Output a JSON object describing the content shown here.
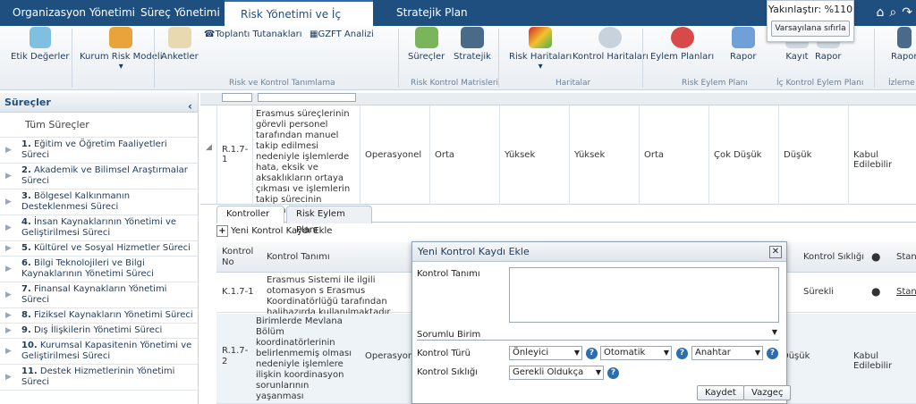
{
  "nav": {
    "tabs": [
      "Organizasyon Yönetimi",
      "Süreç Yönetimi",
      "Risk Yönetimi ve İç Kontrol",
      "Stratejik Plan"
    ]
  },
  "zoom": {
    "label": "Yakınlaştır: %110",
    "reset": "Varsayılana sıfırla"
  },
  "ribbon": {
    "buttons": [
      "Etik Değerler",
      "Kurum Risk Modeli",
      "Anketler",
      "Toplantı Tutanakları",
      "GZFT Analizi",
      "Süreçler",
      "Stratejik",
      "Risk Haritaları",
      "Kontrol Haritaları",
      "Eylem Planları",
      "Rapor",
      "Kayıt",
      "Rapor",
      "Rapor"
    ],
    "groups": [
      "Risk ve Kontrol Tanımlama",
      "Risk Kontrol Matrisleri",
      "Haritalar",
      "Risk Eylem Planı",
      "İç Kontrol Eylem Planı",
      "İzleme ve"
    ]
  },
  "sidebar": {
    "title": "Süreçler",
    "all": "Tüm Süreçler",
    "items": [
      {
        "n": "1.",
        "t": "Eğitim ve Öğretim Faaliyetleri Süreci"
      },
      {
        "n": "2.",
        "t": "Akademik ve Bilimsel Araştırmalar Süreci"
      },
      {
        "n": "3.",
        "t": "Bölgesel Kalkınmanın Desteklenmesi Süreci"
      },
      {
        "n": "4.",
        "t": "İnsan Kaynaklarının Yönetimi ve Geliştirilmesi Süreci"
      },
      {
        "n": "5.",
        "t": "Kültürel ve Sosyal Hizmetler Süreci"
      },
      {
        "n": "6.",
        "t": "Bilgi Teknolojileri ve Bilgi Kaynaklarının Yönetimi Süreci"
      },
      {
        "n": "7.",
        "t": "Finansal Kaynakların Yönetimi Süreci"
      },
      {
        "n": "8.",
        "t": "Fiziksel Kaynakların Yönetimi Süreci"
      },
      {
        "n": "9.",
        "t": "Dış İlişkilerin Yönetimi Süreci"
      },
      {
        "n": "10.",
        "t": "Kurumsal Kapasitenin Yönetimi ve Geliştirilmesi Süreci"
      },
      {
        "n": "11.",
        "t": "Destek Hizmetlerinin Yönetimi Süreci"
      }
    ]
  },
  "risk": {
    "code": "R.1.7-1",
    "desc": "Erasmus süreçlerinin görevli personel tarafından manuel takip edilmesi nedeniyle işlemlerde hata, eksik ve aksaklıkların ortaya çıkması ve işlemlerin takip sürecinin uzaması",
    "type": "Operasyonel",
    "v1": "Orta",
    "v2": "Yüksek",
    "v3": "Yüksek",
    "v4": "Orta",
    "v5": "Çok Düşük",
    "v6": "Düşük",
    "v7": "Kabul Edilebilir"
  },
  "tabs": [
    "Kontroller",
    "Risk Eylem Planı"
  ],
  "newcontrol": "Yeni Kontrol Kaydı Ekle",
  "ktable": {
    "h_no": "Kontrol No",
    "h_desc": "Kontrol Tanımı",
    "h_freq": "Kontrol Sıklığı",
    "h_std": "Stand",
    "row": {
      "no": "K.1.7-1",
      "desc": "Erasmus Sistemi ile ilgili otomasyon s Erasmus Koordinatörlüğü tarafından halihazırda kullanılmaktadır.",
      "freq": "Sürekli",
      "std": "Stand"
    }
  },
  "risk2": {
    "code": "R.1.7-2",
    "desc": "Birimlerde Mevlana Bölüm koordinatörlerinin belirlenmemiş olması nedeniyle işlemlere ilişkin koordinasyon sorunlarının yaşanması",
    "type": "Operasyone",
    "v6": "Düşük",
    "v7": "Kabul Edilebilir"
  },
  "dialog": {
    "title": "Yeni Kontrol Kaydı Ekle",
    "l_desc": "Kontrol Tanımı",
    "l_unit": "Sorumlu Birim",
    "l_type": "Kontrol Türü",
    "l_freq": "Kontrol Sıklığı",
    "type1": "Önleyici",
    "type2": "Otomatik",
    "type3": "Anahtar",
    "freq": "Gerekli Oldukça",
    "save": "Kaydet",
    "cancel": "Vazgeç"
  }
}
